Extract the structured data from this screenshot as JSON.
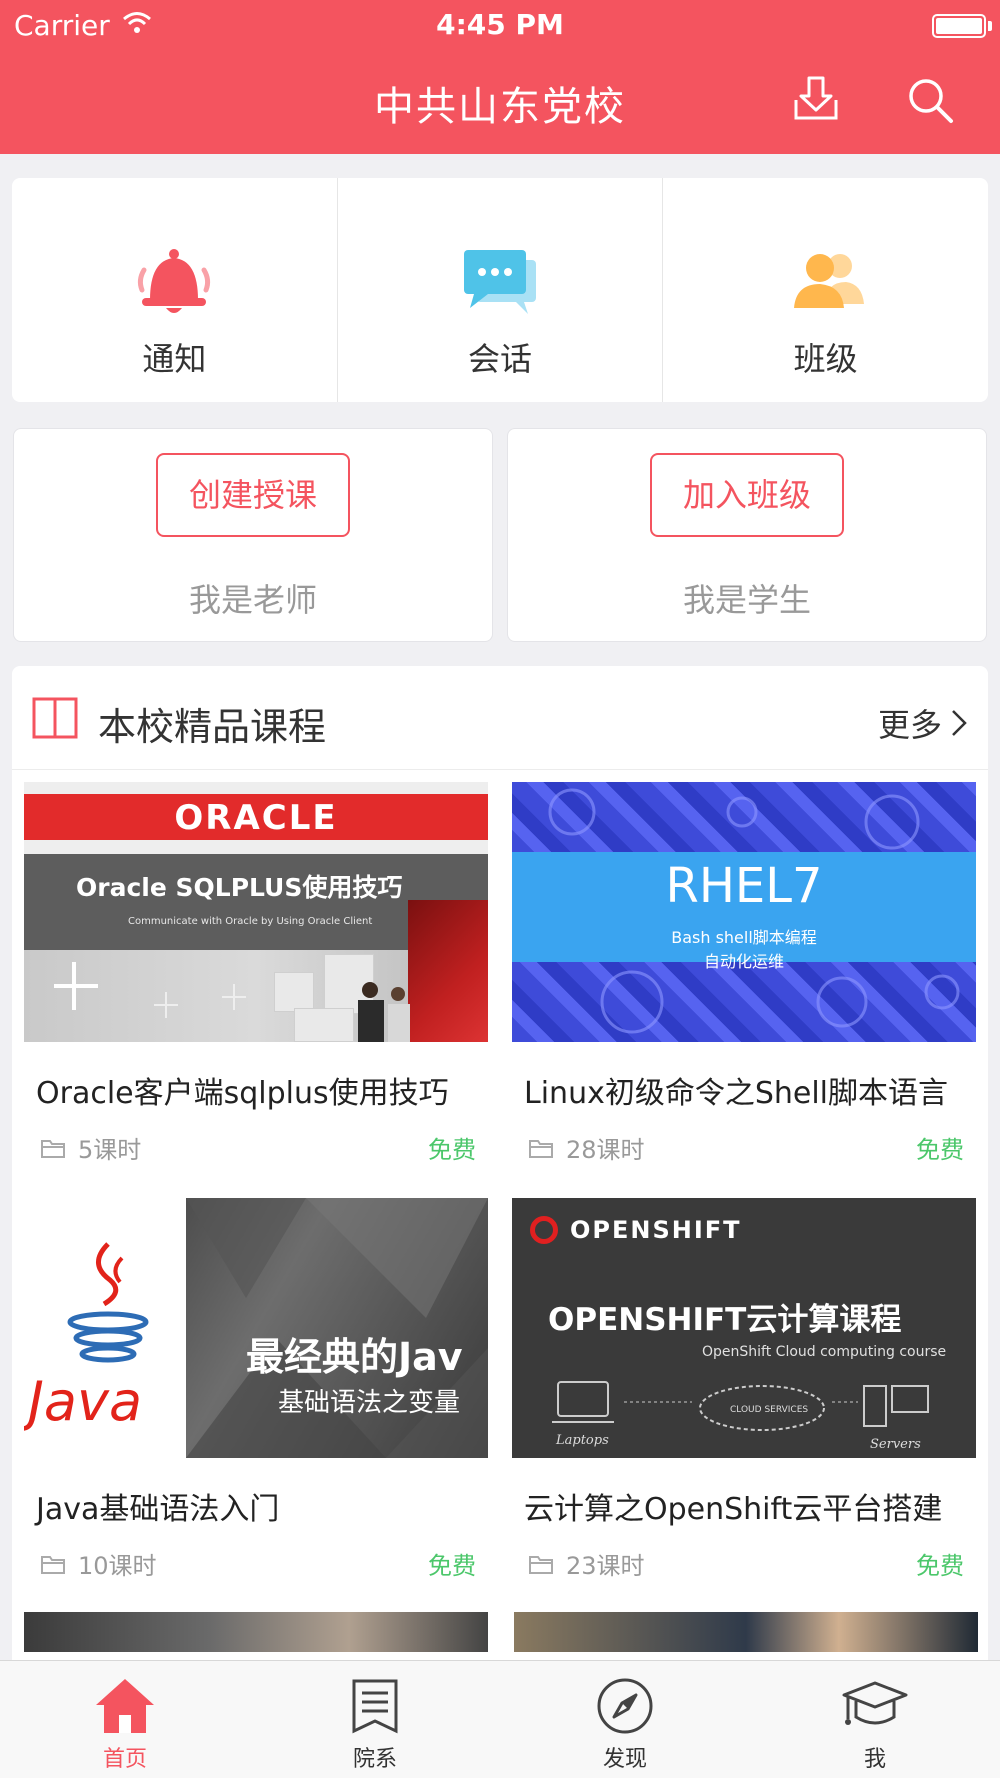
{
  "status_bar": {
    "carrier": "Carrier",
    "time": "4:45 PM"
  },
  "nav": {
    "title": "中共山东党校",
    "download_icon": "download-icon",
    "search_icon": "search-icon"
  },
  "quick_entries": [
    {
      "label": "通知",
      "icon": "bell-icon",
      "color": "#f4545f"
    },
    {
      "label": "会话",
      "icon": "chat-icon",
      "color": "#4fc3e8"
    },
    {
      "label": "班级",
      "icon": "people-icon",
      "color": "#ffb74d"
    }
  ],
  "roles": {
    "teacher": {
      "button": "创建授课",
      "caption": "我是老师"
    },
    "student": {
      "button": "加入班级",
      "caption": "我是学生"
    }
  },
  "courses_section": {
    "title": "本校精品课程",
    "more": "更多",
    "items": [
      {
        "title": "Oracle客户端sqlplus使用技巧",
        "lessons": "5课时",
        "price": "免费",
        "thumb": {
          "logo": "ORACLE",
          "headline": "Oracle SQLPLUS使用技巧",
          "sub": "Communicate with Oracle by Using Oracle Client"
        }
      },
      {
        "title": "Linux初级命令之Shell脚本语言",
        "lessons": "28课时",
        "price": "免费",
        "thumb": {
          "headline": "RHEL7",
          "sub1": "Bash shell脚本编程",
          "sub2": "自动化运维"
        }
      },
      {
        "title": "Java基础语法入门",
        "lessons": "10课时",
        "price": "免费",
        "thumb": {
          "logo": "Java",
          "headline": "最经典的Jav",
          "sub": "基础语法之变量"
        }
      },
      {
        "title": "云计算之OpenShift云平台搭建",
        "lessons": "23课时",
        "price": "免费",
        "thumb": {
          "logo": "OPENSHIFT",
          "headline": "OPENSHIFT云计算课程",
          "sub": "OpenShift Cloud computing course",
          "label_laptops": "Laptops",
          "label_cloud": "CLOUD SERVICES",
          "label_servers": "Servers"
        }
      }
    ]
  },
  "tabbar": [
    {
      "label": "首页",
      "icon": "home-icon",
      "active": true
    },
    {
      "label": "院系",
      "icon": "list-icon",
      "active": false
    },
    {
      "label": "发现",
      "icon": "compass-icon",
      "active": false
    },
    {
      "label": "我",
      "icon": "graduation-cap-icon",
      "active": false
    }
  ],
  "colors": {
    "brand": "#f4545f",
    "free": "#4cc76b"
  }
}
